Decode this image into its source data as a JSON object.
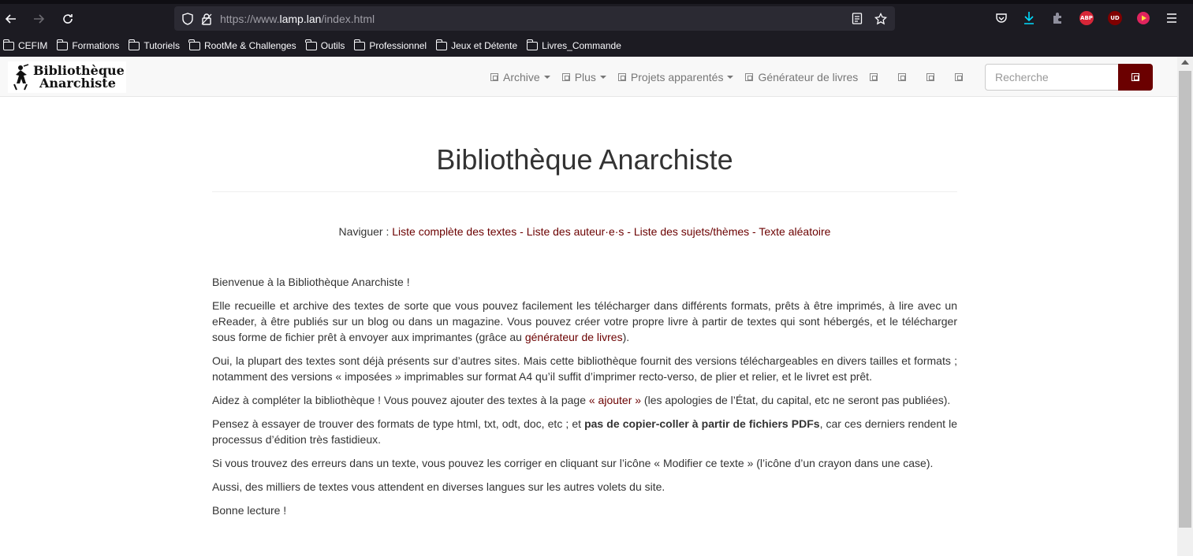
{
  "browser": {
    "url_prefix": "https://www.",
    "url_host": "lamp.lan",
    "url_path": "/index.html",
    "bookmarks": [
      "CEFIM",
      "Formations",
      "Tutoriels",
      "RootMe & Challenges",
      "Outils",
      "Professionnel",
      "Jeux et Détente",
      "Livres_Commande"
    ],
    "extensions": {
      "abp": "ABP",
      "ud": "UD"
    },
    "colors": {
      "chrome_bg": "#1c1b22",
      "urlbar_bg": "#2b2a33",
      "download_accent": "#00ddff"
    }
  },
  "site": {
    "logo_line1": "Bibliothèque",
    "logo_line2": "Anarchiste",
    "menu": {
      "archive": "Archive",
      "plus": "Plus",
      "projets": "Projets apparentés",
      "generateur": "Générateur de livres"
    },
    "search_placeholder": "Recherche",
    "accent_color": "#6b0000"
  },
  "main": {
    "title": "Bibliothèque Anarchiste",
    "nav_label": "Naviguer :",
    "nav_links": [
      "Liste complète des textes",
      "Liste des auteur·e·s",
      "Liste des sujets/thèmes",
      "Texte aléatoire"
    ],
    "nav_sep": " - ",
    "p1": "Bienvenue à la Bibliothèque Anarchiste !",
    "p2_a": "Elle recueille et archive des textes de sorte que vous pouvez facilement les télécharger dans différents formats, prêts à être imprimés, à lire avec un eReader, à être publiés sur un blog ou dans un magazine. Vous pouvez créer votre propre livre à partir de textes qui sont hébergés, et le télécharger sous forme de fichier prêt à envoyer aux imprimantes (grâce au ",
    "p2_link": "générateur de livres",
    "p2_b": ").",
    "p3": "Oui, la plupart des textes sont déjà présents sur d’autres sites. Mais cette bibliothèque fournit des versions téléchargeables en divers tailles et formats ; notamment des versions « imposées » imprimables sur format A4 qu’il suffit d’imprimer recto-verso, de plier et relier, et le livret est prêt.",
    "p4_a": "Aidez à compléter la bibliothèque ! Vous pouvez ajouter des textes à la page ",
    "p4_link": "« ajouter »",
    "p4_b": " (les apologies de l’État, du capital, etc ne seront pas publiées).",
    "p5_a": "Pensez à essayer de trouver des formats de type html, txt, odt, doc, etc ; et ",
    "p5_bold": "pas de copier-coller à partir de fichiers PDFs",
    "p5_b": ", car ces derniers rendent le processus d’édition très fastidieux.",
    "p6": "Si vous trouvez des erreurs dans un texte, vous pouvez les corriger en cliquant sur l’icône « Modifier ce texte » (l’icône d’un crayon dans une case).",
    "p7": "Aussi, des milliers de textes vous attendent en diverses langues sur les autres volets du site.",
    "p8": "Bonne lecture !"
  }
}
